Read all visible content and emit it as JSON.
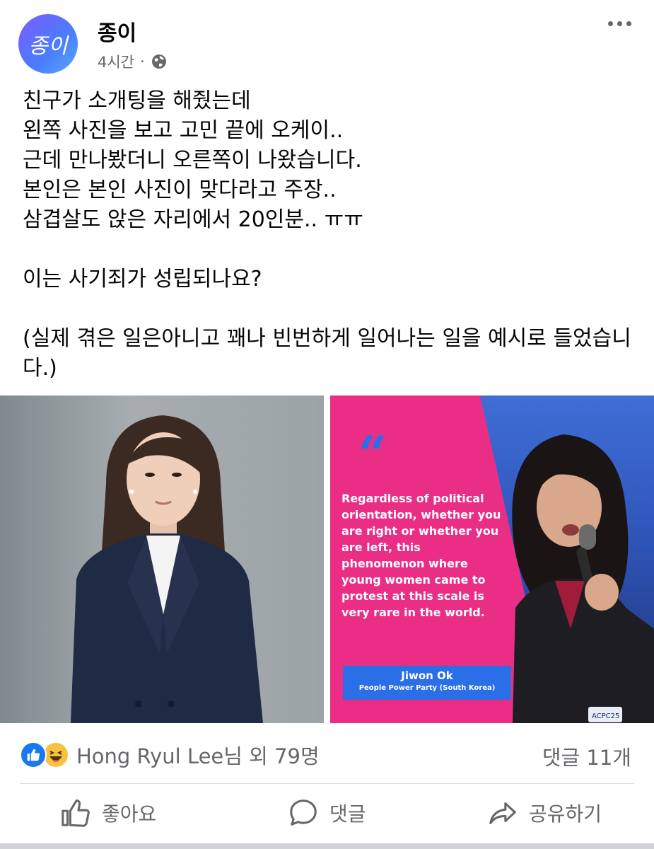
{
  "post": {
    "author": "종이",
    "avatar_text": "종이",
    "time": "4시간",
    "separator": "·",
    "text_lines": [
      "친구가 소개팅을 해줬는데",
      "왼쪽 사진을 보고 고민 끝에 오케이..",
      "근데 만나봤더니 오른쪽이 나왔습니다.",
      "본인은 본인 사진이 맞다라고 주장..",
      "삼겹살도 앉은 자리에서 20인분.. ㅠㅠ"
    ],
    "question": "이는 사기죄가 성립되나요?",
    "disclaimer": "(실제 겪은 일은아니고 꽤나 빈번하게 일어나는 일을 예시로 들었습니다.)"
  },
  "right_image": {
    "quote_mark": "“",
    "quote": "Regardless of political orientation, whether you are right or whether you are left, this phenomenon where young women came to protest at this scale is very rare in the world.",
    "speaker_name": "Jiwon Ok",
    "speaker_party": "People Power Party (South Korea)",
    "badge_text": "ACPC25"
  },
  "reactions": {
    "text": "Hong Ryul Lee님 외 79명",
    "comments": "댓글 11개"
  },
  "actions": {
    "like": "좋아요",
    "comment": "댓글",
    "share": "공유하기"
  },
  "colors": {
    "accent": "#1877f2",
    "secondary_text": "#65676b",
    "magenta": "#ea2e86",
    "quote_blue": "#2b6fe8"
  }
}
